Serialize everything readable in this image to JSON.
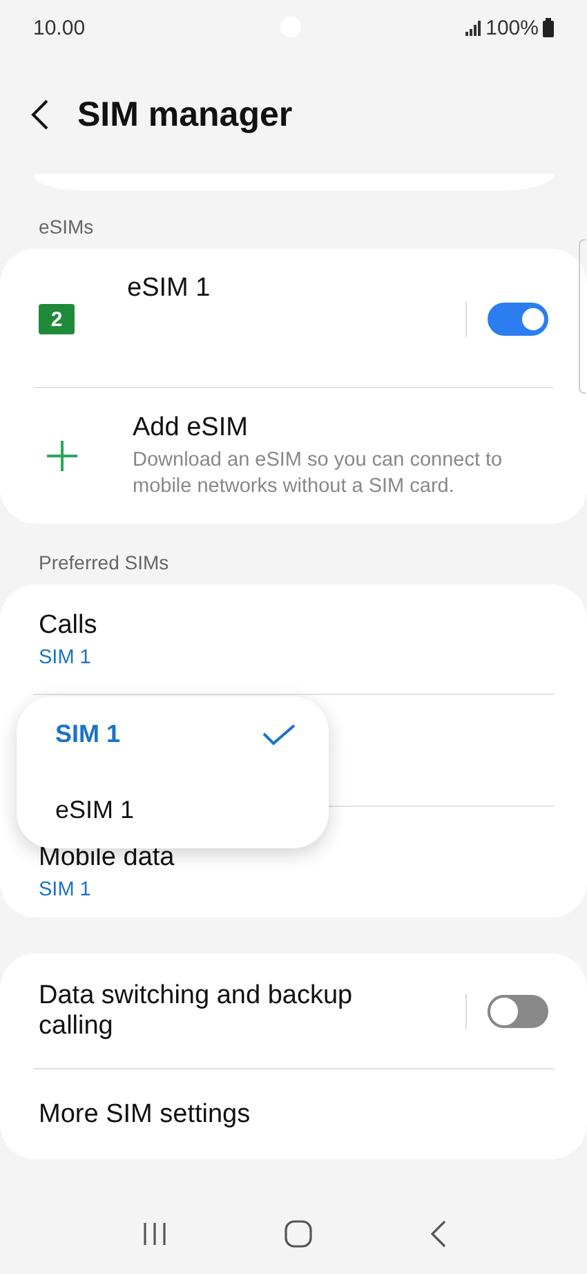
{
  "status_bar": {
    "time": "10.00",
    "battery": "100%"
  },
  "header": {
    "title": "SIM manager"
  },
  "esims": {
    "label": "eSIMs",
    "items": [
      {
        "kind": "sim",
        "badge": "2",
        "title": "eSIM 1",
        "on": true
      },
      {
        "kind": "add",
        "title": "Add eSIM",
        "subtitle": "Download an eSIM so you can connect to mobile networks without a SIM card."
      }
    ]
  },
  "preferred": {
    "label": "Preferred SIMs",
    "items": [
      {
        "title": "Calls",
        "value": "SIM 1"
      },
      {
        "title": "Mobile data",
        "value": "SIM 1"
      }
    ],
    "popup": [
      {
        "label": "SIM 1",
        "selected": true
      },
      {
        "label": "eSIM 1",
        "selected": false
      }
    ]
  },
  "more": {
    "items": [
      {
        "kind": "toggle",
        "title": "Data switching and backup calling",
        "on": false
      },
      {
        "kind": "link",
        "title": "More SIM settings"
      }
    ]
  }
}
